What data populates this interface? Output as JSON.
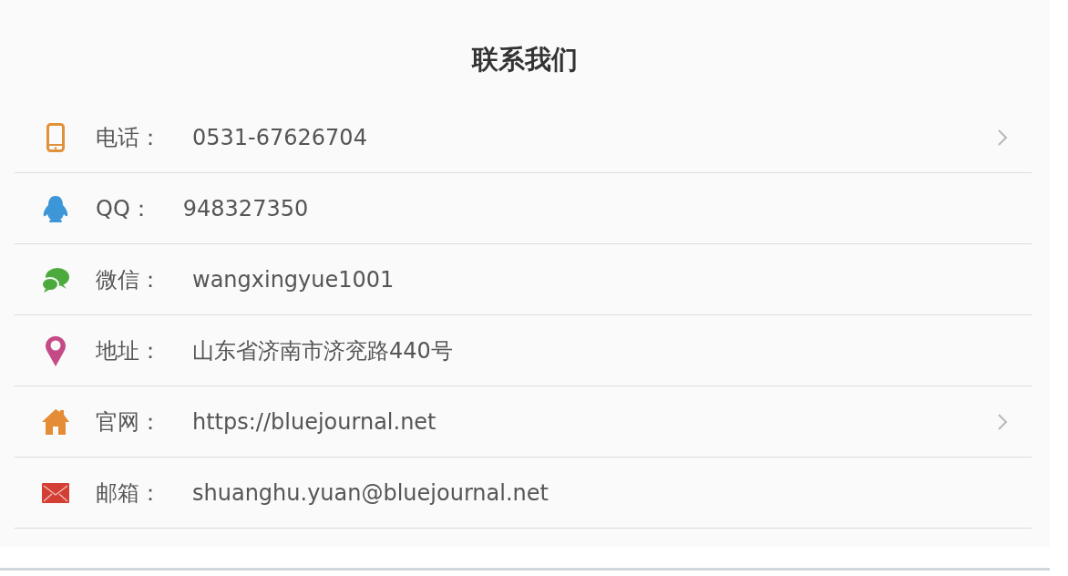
{
  "title": "联系我们",
  "rows": [
    {
      "kind": "phone",
      "label": "电话：",
      "value": "0531-67626704",
      "has_arrow": true
    },
    {
      "kind": "qq",
      "label": "QQ：",
      "value": "948327350",
      "has_arrow": false
    },
    {
      "kind": "wechat",
      "label": "微信：",
      "value": "wangxingyue1001",
      "has_arrow": false
    },
    {
      "kind": "location",
      "label": "地址：",
      "value": "山东省济南市济兖路440号",
      "has_arrow": false
    },
    {
      "kind": "home",
      "label": "官网：",
      "value": "https://bluejournal.net",
      "has_arrow": true
    },
    {
      "kind": "mail",
      "label": "邮箱：",
      "value": "shuanghu.yuan@bluejournal.net",
      "has_arrow": false
    }
  ]
}
